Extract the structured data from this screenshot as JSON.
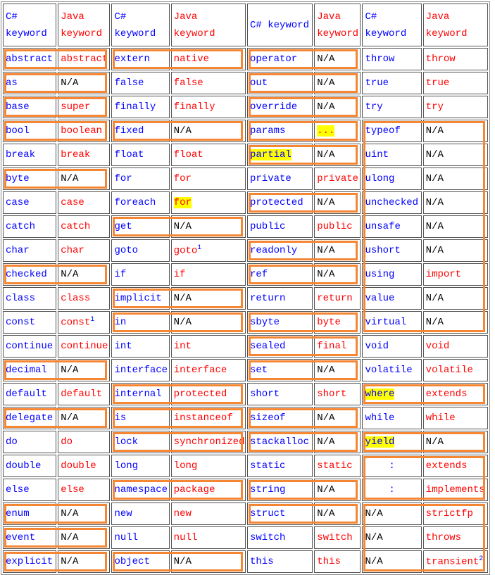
{
  "colors": {
    "csharp": "#0000ff",
    "java": "#ff0000",
    "na": "#000000",
    "highlight": "#ffff00",
    "box": "#f58634"
  },
  "header": [
    {
      "text": "C# keyword",
      "c": "b"
    },
    {
      "text": "Java keyword",
      "c": "r"
    },
    {
      "text": "C# keyword",
      "c": "b"
    },
    {
      "text": "Java keyword",
      "c": "r"
    },
    {
      "text": "C# keyword",
      "c": "b"
    },
    {
      "text": "Java keyword",
      "c": "r"
    },
    {
      "text": "C# keyword",
      "c": "b"
    },
    {
      "text": "Java keyword",
      "c": "r"
    }
  ],
  "rows": [
    [
      [
        "abstract",
        "b"
      ],
      [
        "abstract",
        "r"
      ],
      [
        "extern",
        "b"
      ],
      [
        "native",
        "r"
      ],
      [
        "operator",
        "b"
      ],
      [
        "N/A",
        "k"
      ],
      [
        "throw",
        "b"
      ],
      [
        "throw",
        "r"
      ]
    ],
    [
      [
        "as",
        "b"
      ],
      [
        "N/A",
        "k"
      ],
      [
        "false",
        "b"
      ],
      [
        "false",
        "r"
      ],
      [
        "out",
        "b"
      ],
      [
        "N/A",
        "k"
      ],
      [
        "true",
        "b"
      ],
      [
        "true",
        "r"
      ]
    ],
    [
      [
        "base",
        "b"
      ],
      [
        "super",
        "r"
      ],
      [
        "finally",
        "b"
      ],
      [
        "finally",
        "r"
      ],
      [
        "override",
        "b"
      ],
      [
        "N/A",
        "k"
      ],
      [
        "try",
        "b"
      ],
      [
        "try",
        "r"
      ]
    ],
    [
      [
        "bool",
        "b"
      ],
      [
        "boolean",
        "r"
      ],
      [
        "fixed",
        "b"
      ],
      [
        "N/A",
        "k"
      ],
      [
        "params",
        "b"
      ],
      [
        "...",
        "r",
        "hl"
      ],
      [
        "typeof",
        "b"
      ],
      [
        "N/A",
        "k"
      ]
    ],
    [
      [
        "break",
        "b"
      ],
      [
        "break",
        "r"
      ],
      [
        "float",
        "b"
      ],
      [
        "float",
        "r"
      ],
      [
        "partial",
        "b",
        "hl"
      ],
      [
        "N/A",
        "k"
      ],
      [
        "uint",
        "b"
      ],
      [
        "N/A",
        "k"
      ]
    ],
    [
      [
        "byte",
        "b"
      ],
      [
        "N/A",
        "k"
      ],
      [
        "for",
        "b"
      ],
      [
        "for",
        "r"
      ],
      [
        "private",
        "b"
      ],
      [
        "private",
        "r"
      ],
      [
        "ulong",
        "b"
      ],
      [
        "N/A",
        "k"
      ]
    ],
    [
      [
        "case",
        "b"
      ],
      [
        "case",
        "r"
      ],
      [
        "foreach",
        "b"
      ],
      [
        "for",
        "r",
        "hl"
      ],
      [
        "protected",
        "b"
      ],
      [
        "N/A",
        "k"
      ],
      [
        "unchecked",
        "b"
      ],
      [
        "N/A",
        "k"
      ]
    ],
    [
      [
        "catch",
        "b"
      ],
      [
        "catch",
        "r"
      ],
      [
        "get",
        "b"
      ],
      [
        "N/A",
        "k"
      ],
      [
        "public",
        "b"
      ],
      [
        "public",
        "r"
      ],
      [
        "unsafe",
        "b"
      ],
      [
        "N/A",
        "k"
      ]
    ],
    [
      [
        "char",
        "b"
      ],
      [
        "char",
        "r"
      ],
      [
        "goto",
        "b"
      ],
      [
        "goto",
        "r",
        "",
        "1"
      ],
      [
        "readonly",
        "b"
      ],
      [
        "N/A",
        "k"
      ],
      [
        "ushort",
        "b"
      ],
      [
        "N/A",
        "k"
      ]
    ],
    [
      [
        "checked",
        "b"
      ],
      [
        "N/A",
        "k"
      ],
      [
        "if",
        "b"
      ],
      [
        "if",
        "r"
      ],
      [
        "ref",
        "b"
      ],
      [
        "N/A",
        "k"
      ],
      [
        "using",
        "b"
      ],
      [
        "import",
        "r"
      ]
    ],
    [
      [
        "class",
        "b"
      ],
      [
        "class",
        "r"
      ],
      [
        "implicit",
        "b"
      ],
      [
        "N/A",
        "k"
      ],
      [
        "return",
        "b"
      ],
      [
        "return",
        "r"
      ],
      [
        "value",
        "b"
      ],
      [
        "N/A",
        "k"
      ]
    ],
    [
      [
        "const",
        "b"
      ],
      [
        "const",
        "r",
        "",
        "1"
      ],
      [
        "in",
        "b"
      ],
      [
        "N/A",
        "k"
      ],
      [
        "sbyte",
        "b"
      ],
      [
        "byte",
        "r"
      ],
      [
        "virtual",
        "b"
      ],
      [
        "N/A",
        "k"
      ]
    ],
    [
      [
        "continue",
        "b"
      ],
      [
        "continue",
        "r"
      ],
      [
        "int",
        "b"
      ],
      [
        "int",
        "r"
      ],
      [
        "sealed",
        "b"
      ],
      [
        "final",
        "r"
      ],
      [
        "void",
        "b"
      ],
      [
        "void",
        "r"
      ]
    ],
    [
      [
        "decimal",
        "b"
      ],
      [
        "N/A",
        "k"
      ],
      [
        "interface",
        "b"
      ],
      [
        "interface",
        "r"
      ],
      [
        "set",
        "b"
      ],
      [
        "N/A",
        "k"
      ],
      [
        "volatile",
        "b"
      ],
      [
        "volatile",
        "r"
      ]
    ],
    [
      [
        "default",
        "b"
      ],
      [
        "default",
        "r"
      ],
      [
        "internal",
        "b"
      ],
      [
        "protected",
        "r"
      ],
      [
        "short",
        "b"
      ],
      [
        "short",
        "r"
      ],
      [
        "where",
        "b",
        "hl"
      ],
      [
        "extends",
        "r"
      ]
    ],
    [
      [
        "delegate",
        "b"
      ],
      [
        "N/A",
        "k"
      ],
      [
        "is",
        "b"
      ],
      [
        "instanceof",
        "r"
      ],
      [
        "sizeof",
        "b"
      ],
      [
        "N/A",
        "k"
      ],
      [
        "while",
        "b"
      ],
      [
        "while",
        "r"
      ]
    ],
    [
      [
        "do",
        "b"
      ],
      [
        "do",
        "r"
      ],
      [
        "lock",
        "b"
      ],
      [
        "synchronized",
        "r"
      ],
      [
        "stackalloc",
        "b"
      ],
      [
        "N/A",
        "k"
      ],
      [
        "yield",
        "b",
        "hl"
      ],
      [
        "N/A",
        "k"
      ]
    ],
    [
      [
        "double",
        "b"
      ],
      [
        "double",
        "r"
      ],
      [
        "long",
        "b"
      ],
      [
        "long",
        "r"
      ],
      [
        "static",
        "b"
      ],
      [
        "static",
        "r"
      ],
      [
        ":",
        "b",
        "center"
      ],
      [
        "extends",
        "r"
      ]
    ],
    [
      [
        "else",
        "b"
      ],
      [
        "else",
        "r"
      ],
      [
        "namespace",
        "b"
      ],
      [
        "package",
        "r"
      ],
      [
        "string",
        "b"
      ],
      [
        "N/A",
        "k"
      ],
      [
        ":",
        "b",
        "center"
      ],
      [
        "implements",
        "r"
      ]
    ],
    [
      [
        "enum",
        "b"
      ],
      [
        "N/A",
        "k"
      ],
      [
        "new",
        "b"
      ],
      [
        "new",
        "r"
      ],
      [
        "struct",
        "b"
      ],
      [
        "N/A",
        "k"
      ],
      [
        "N/A",
        "k"
      ],
      [
        "strictfp",
        "r"
      ]
    ],
    [
      [
        "event",
        "b"
      ],
      [
        "N/A",
        "k"
      ],
      [
        "null",
        "b"
      ],
      [
        "null",
        "r"
      ],
      [
        "switch",
        "b"
      ],
      [
        "switch",
        "r"
      ],
      [
        "N/A",
        "k"
      ],
      [
        "throws",
        "r"
      ]
    ],
    [
      [
        "explicit",
        "b"
      ],
      [
        "N/A",
        "k"
      ],
      [
        "object",
        "b"
      ],
      [
        "N/A",
        "k"
      ],
      [
        "this",
        "b"
      ],
      [
        "this",
        "r"
      ],
      [
        "N/A",
        "k"
      ],
      [
        "transient",
        "r",
        "",
        "2"
      ]
    ]
  ],
  "highlight_groups": [
    {
      "pair": 0,
      "rows": [
        [
          0,
          0
        ],
        [
          1,
          1
        ],
        [
          2,
          2
        ],
        [
          3,
          3
        ],
        [
          5,
          5
        ],
        [
          9,
          9
        ],
        [
          13,
          13
        ],
        [
          15,
          15
        ],
        [
          19,
          19
        ],
        [
          20,
          20
        ],
        [
          21,
          21
        ]
      ]
    },
    {
      "pair": 1,
      "rows": [
        [
          0,
          0
        ],
        [
          3,
          3
        ],
        [
          7,
          7
        ],
        [
          10,
          10
        ],
        [
          11,
          11
        ],
        [
          14,
          14
        ],
        [
          15,
          15
        ],
        [
          16,
          16
        ],
        [
          18,
          18
        ],
        [
          21,
          21
        ]
      ]
    },
    {
      "pair": 2,
      "rows": [
        [
          0,
          0
        ],
        [
          1,
          1
        ],
        [
          2,
          2
        ],
        [
          3,
          3
        ],
        [
          4,
          4
        ],
        [
          6,
          6
        ],
        [
          8,
          8
        ],
        [
          9,
          9
        ],
        [
          11,
          11
        ],
        [
          12,
          12
        ],
        [
          13,
          13
        ],
        [
          15,
          15
        ],
        [
          16,
          16
        ],
        [
          18,
          18
        ],
        [
          19,
          19
        ]
      ]
    },
    {
      "pair": 3,
      "rows": [
        [
          3,
          11
        ],
        [
          14,
          14
        ],
        [
          16,
          16
        ],
        [
          17,
          18
        ],
        [
          19,
          21
        ]
      ]
    }
  ]
}
